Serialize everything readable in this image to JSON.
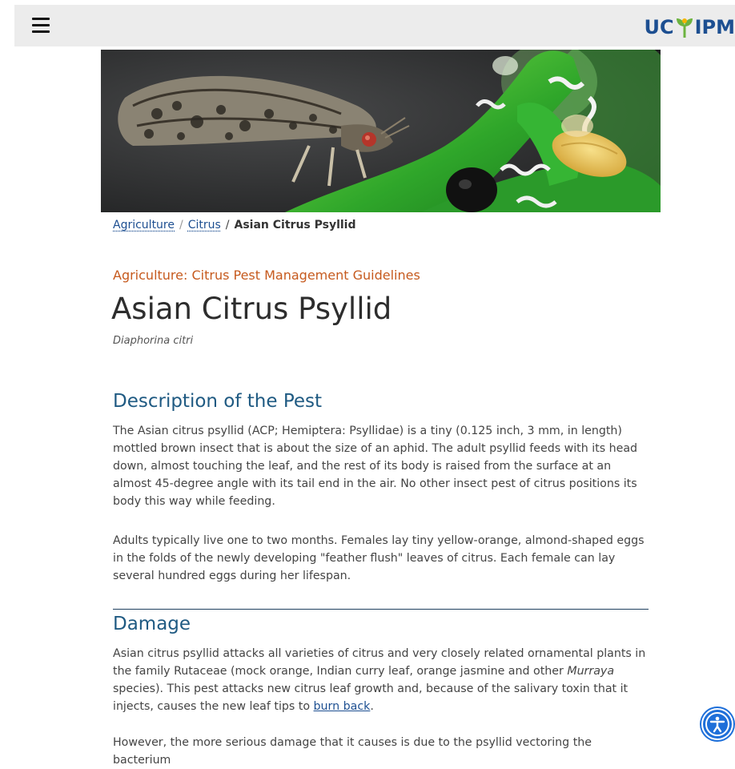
{
  "header": {
    "menu_icon": "hamburger-menu-icon",
    "logo_text_left": "UC",
    "logo_text_right": "IPM",
    "logo_icon": "leaf-sprout-icon",
    "brand_color": "#1d4f91"
  },
  "hero": {
    "alt": "Asian citrus psyllid adult on green citrus stem with nymphs"
  },
  "breadcrumb": {
    "items": [
      "Agriculture",
      "Citrus"
    ],
    "separator": "/",
    "current": "Asian Citrus Psyllid"
  },
  "page": {
    "eyebrow": "Agriculture: Citrus Pest Management Guidelines",
    "title": "Asian Citrus Psyllid",
    "scientific_name": "Diaphorina citri",
    "accent_color": "#c65a1e",
    "heading_color": "#1f5a82"
  },
  "sections": {
    "description": {
      "heading": "Description of the Pest",
      "p1": "The Asian citrus psyllid (ACP; Hemiptera: Psyllidae) is a tiny (0.125 inch, 3 mm, in length) mottled brown insect that is about the size of an aphid. The adult psyllid feeds with its head down, almost touching the leaf, and the rest of its body is raised from the surface at an almost 45-degree angle with its tail end in the air. No other insect pest of citrus positions its body this way while feeding.",
      "p2": "Adults typically live one to two months. Females lay tiny yellow-orange, almond-shaped eggs in the folds of the newly developing \"feather flush\" leaves of citrus. Each female can lay several hundred eggs during her lifespan."
    },
    "damage": {
      "heading": "Damage",
      "p1_a": "Asian citrus psyllid attacks all varieties of citrus and very closely related ornamental plants in the family Rutaceae (mock orange, Indian curry leaf, orange jasmine and other ",
      "p1_italic": "Murraya",
      "p1_b": " species). This pest attacks new citrus leaf growth and, because of the salivary toxin that it injects, causes the new leaf tips to ",
      "p1_link": "burn back",
      "p1_end": ".",
      "p2": "However, the more serious damage that it causes is due to the psyllid vectoring the bacterium"
    }
  },
  "accessibility_button": {
    "icon": "accessibility-person-icon"
  }
}
